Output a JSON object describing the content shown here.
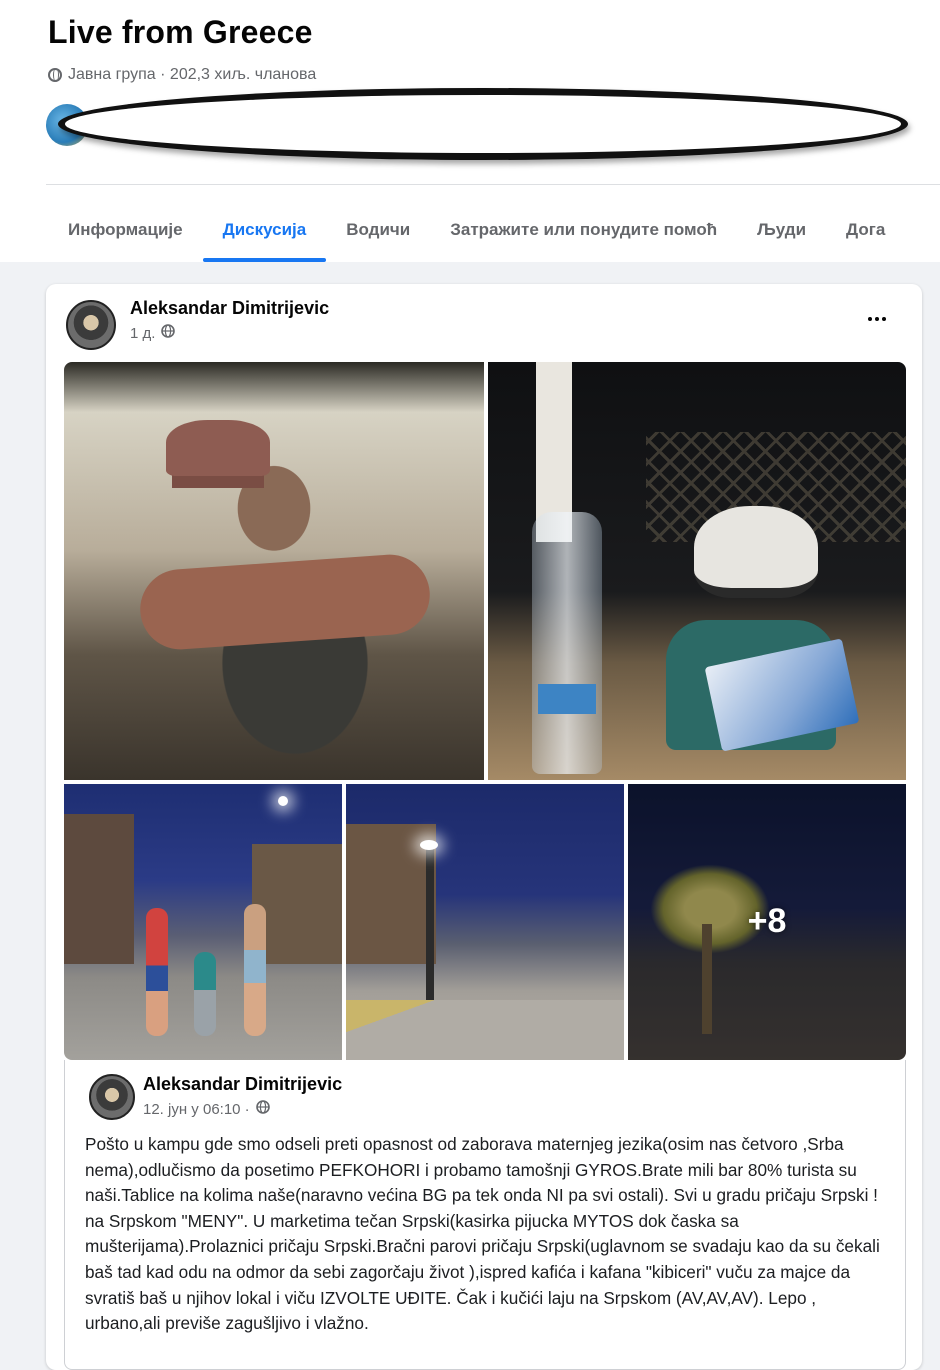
{
  "group": {
    "title": "Live from Greece",
    "meta": "Јавна група · 202,3 хиљ. чланова"
  },
  "tabs": [
    {
      "label": "Информације",
      "active": false
    },
    {
      "label": "Дискусија",
      "active": true
    },
    {
      "label": "Водичи",
      "active": false
    },
    {
      "label": "Затражите или понудите помоћ",
      "active": false
    },
    {
      "label": "Људи",
      "active": false
    },
    {
      "label": "Дога",
      "active": false
    }
  ],
  "post": {
    "author": "Aleksandar Dimitrijevic",
    "time": "1 д.",
    "privacy_icon": "globe-icon",
    "more_icon": "more-horizontal-icon",
    "extra_photos": "+8",
    "photo_count_shown": 5
  },
  "shared": {
    "author": "Aleksandar Dimitrijevic",
    "time": "12. јун у 06:10 ·",
    "text": "Pošto u kampu gde smo odseli preti opasnost od zaborava maternjeg jezika(osim nas četvoro ,Srba nema),odlučismo da posetimo PEFKOHORI i probamo tamošnji GYROS.Brate mili bar 80% turista su naši.Tablice na kolima naše(naravno većina BG pa tek onda NI pa svi ostali). Svi u gradu pričaju Srpski ! na Srpskom \"MENY\". U marketima tečan Srpski(kasirka pijucka MYTOS dok časka sa mušterijama).Prolaznici pričaju Srpski.Bračni parovi pričaju Srpski(uglavnom se svadaju kao da su čekali baš tad kad odu na odmor da sebi zagorčaju život ),ispred kafića i kafana \"kibiceri\" vuču za majce da svratiš baš u njihov lokal i viču IZVOLTE UĐITE. Čak i kučići laju na Srpskom (AV,AV,AV). Lepo , urbano,ali previše zagušljivo i vlažno."
  },
  "colors": {
    "accent": "#1877f2",
    "feed_bg": "#f0f2f5",
    "secondary_text": "#65676b"
  }
}
